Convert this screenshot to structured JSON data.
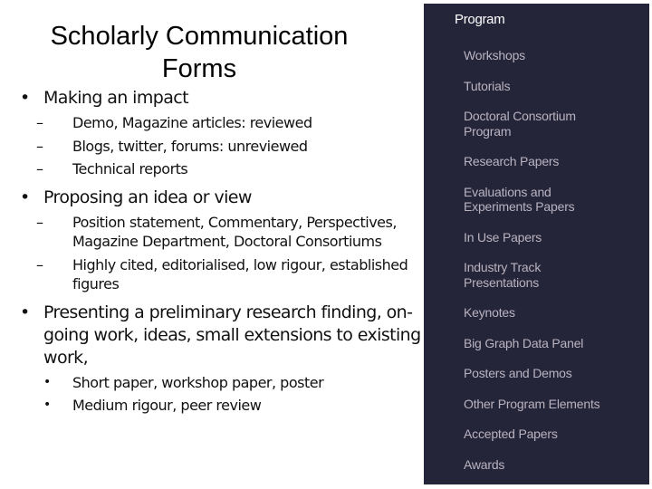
{
  "slide": {
    "title_line1": "Scholarly Communication",
    "title_line2": "Forms",
    "bullet_glyph": "•",
    "dash_glyph": "–",
    "sections": [
      {
        "text": "Making an impact",
        "subitems": [
          "Demo, Magazine articles: reviewed",
          "Blogs, twitter, forums: unreviewed",
          "Technical reports"
        ]
      },
      {
        "text": "Proposing an idea or view",
        "subitems": [
          "Position statement, Commentary, Perspectives, Magazine Department, Doctoral Consortiums",
          "Highly cited, editorialised, low rigour, established figures"
        ]
      },
      {
        "text": "Presenting a preliminary research finding, on-going work, ideas, small extensions to existing work,",
        "subitems": [
          "Short paper, workshop paper, poster",
          "Medium rigour, peer review"
        ]
      }
    ]
  },
  "program_menu": {
    "title": "Program",
    "background": "#25253a",
    "items": [
      "Workshops",
      "Tutorials",
      "Doctoral Consortium Program",
      "Research Papers",
      "Evaluations and Experiments Papers",
      "In Use Papers",
      "Industry Track Presentations",
      "Keynotes",
      "Big Graph Data Panel",
      "Posters and Demos",
      "Other Program Elements",
      "Accepted Papers",
      "Awards"
    ]
  }
}
